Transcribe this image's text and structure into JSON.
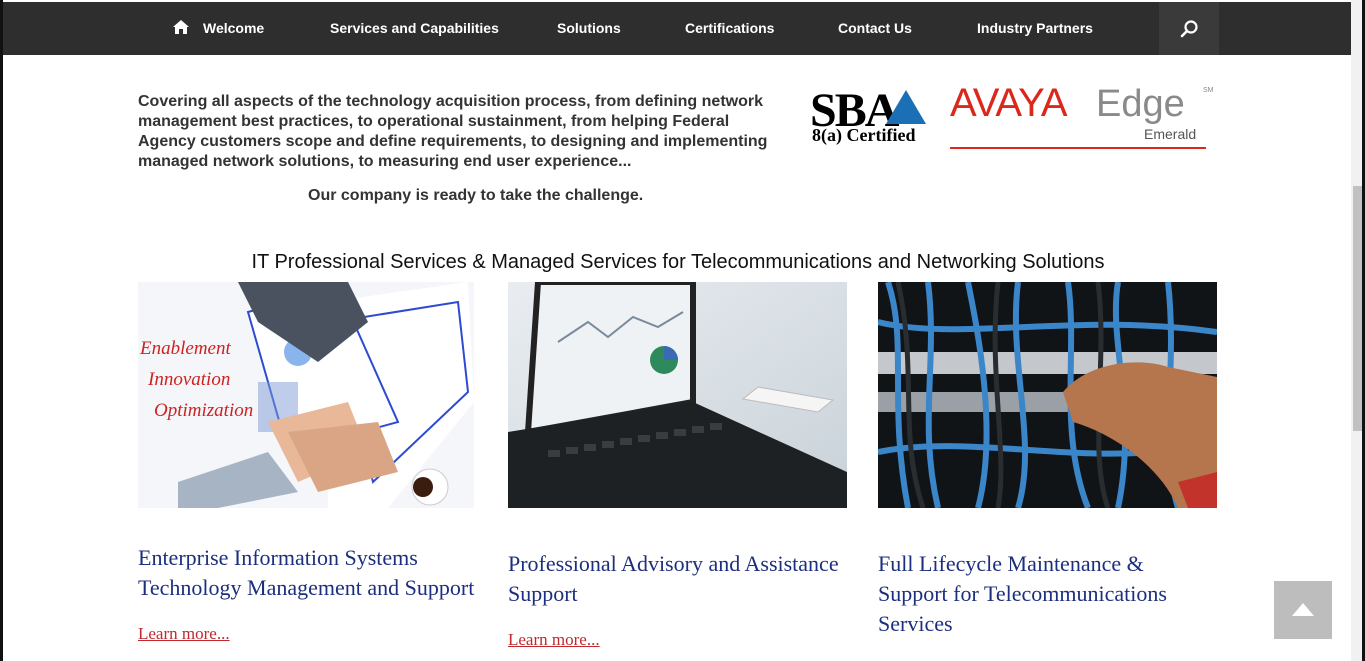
{
  "nav": {
    "items": [
      {
        "label": "Welcome"
      },
      {
        "label": "Services and Capabilities"
      },
      {
        "label": "Solutions"
      },
      {
        "label": "Certifications"
      },
      {
        "label": "Contact Us"
      },
      {
        "label": "Industry Partners"
      }
    ]
  },
  "intro": {
    "text": "Covering all aspects of the technology acquisition process, from defining network management best practices, to operational sustainment, from helping Federal Agency customers scope and define requirements, to designing and implementing managed network solutions, to measuring end user experience...",
    "tagline": "Our company is ready to take the challenge."
  },
  "logos": {
    "sba_main": "SBA",
    "sba_sub": "8(a) Certified",
    "avaya_brand": "AVAYA",
    "avaya_edge": "Edge",
    "avaya_sm": "SM",
    "avaya_tier": "Emerald"
  },
  "section_title": "IT Professional Services & Managed Services for Telecommunications and Networking Solutions",
  "cards": [
    {
      "image_text": [
        "Enablement",
        "Innovation",
        "Optimization"
      ],
      "title": "Enterprise Information Systems Technology Management and Support",
      "link": "Learn more..."
    },
    {
      "title": "Professional Advisory and Assistance Support",
      "link": "Learn more..."
    },
    {
      "title": "Full Lifecycle Maintenance & Support for Telecommunications Services",
      "link": null
    }
  ],
  "colors": {
    "nav_bg": "#2e2e2e",
    "card_title": "#1c2f7e",
    "link": "#c0282d",
    "avaya_red": "#da291c"
  },
  "icons": {
    "home": "home-icon",
    "search": "search-icon",
    "back_to_top": "chevron-up-icon"
  }
}
